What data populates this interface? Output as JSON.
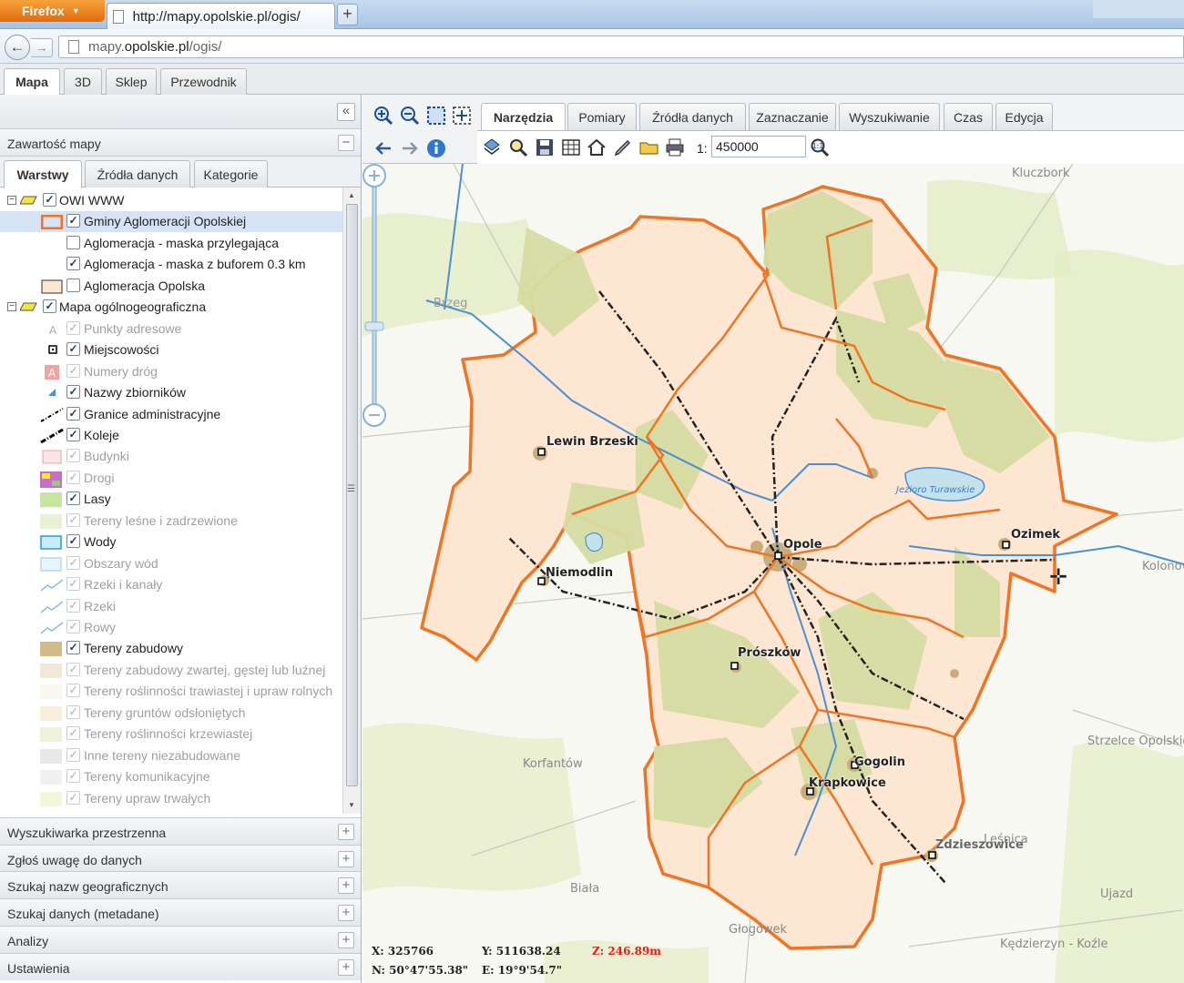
{
  "browser": {
    "app_button": "Firefox",
    "tab_title": "http://mapy.opolskie.pl/ogis/",
    "url_prefix": "mapy.",
    "url_domain": "opolskie.pl",
    "url_suffix": "/ogis/"
  },
  "app_tabs": [
    "Mapa",
    "3D",
    "Sklep",
    "Przewodnik"
  ],
  "left": {
    "section_title": "Zawartość mapy",
    "subtabs": [
      "Warstwy",
      "Źródła danych",
      "Kategorie"
    ],
    "tree": [
      {
        "label": "OWI WWW",
        "checked": true,
        "dim": false
      },
      {
        "label": "Gminy Aglomeracji Opolskiej",
        "checked": true,
        "dim": false
      },
      {
        "label": "Aglomeracja - maska przylegająca",
        "checked": false,
        "dim": false
      },
      {
        "label": "Aglomeracja - maska z buforem 0.3 km",
        "checked": true,
        "dim": false
      },
      {
        "label": "Aglomeracja Opolska",
        "checked": false,
        "dim": false
      },
      {
        "label": "Mapa ogólnogeograficzna",
        "checked": true,
        "dim": false
      },
      {
        "label": "Punkty adresowe",
        "checked": false,
        "dim": true
      },
      {
        "label": "Miejscowości",
        "checked": true,
        "dim": false
      },
      {
        "label": "Numery dróg",
        "checked": false,
        "dim": true
      },
      {
        "label": "Nazwy zbiorników",
        "checked": true,
        "dim": false
      },
      {
        "label": "Granice administracyjne",
        "checked": true,
        "dim": false
      },
      {
        "label": "Koleje",
        "checked": true,
        "dim": false
      },
      {
        "label": "Budynki",
        "checked": false,
        "dim": true
      },
      {
        "label": "Drogi",
        "checked": false,
        "dim": true
      },
      {
        "label": "Lasy",
        "checked": true,
        "dim": false
      },
      {
        "label": "Tereny leśne i zadrzewione",
        "checked": false,
        "dim": true
      },
      {
        "label": "Wody",
        "checked": true,
        "dim": false
      },
      {
        "label": "Obszary wód",
        "checked": false,
        "dim": true
      },
      {
        "label": "Rzeki i kanały",
        "checked": false,
        "dim": true
      },
      {
        "label": "Rzeki",
        "checked": false,
        "dim": true
      },
      {
        "label": "Rowy",
        "checked": false,
        "dim": true
      },
      {
        "label": "Tereny zabudowy",
        "checked": true,
        "dim": false
      },
      {
        "label": "Tereny zabudowy zwartej, gęstej lub luźnej",
        "checked": false,
        "dim": true
      },
      {
        "label": "Tereny roślinności trawiastej i upraw rolnych",
        "checked": false,
        "dim": true
      },
      {
        "label": "Tereny gruntów odsłoniętych",
        "checked": false,
        "dim": true
      },
      {
        "label": "Tereny roślinności krzewiastej",
        "checked": false,
        "dim": true
      },
      {
        "label": "Inne tereny niezabudowane",
        "checked": false,
        "dim": true
      },
      {
        "label": "Tereny komunikacyjne",
        "checked": false,
        "dim": true
      },
      {
        "label": "Tereny upraw trwałych",
        "checked": false,
        "dim": true
      }
    ],
    "accordions": [
      "Wyszukiwarka przestrzenna",
      "Zgłoś uwagę do danych",
      "Szukaj nazw geograficznych",
      "Szukaj danych (metadane)",
      "Analizy",
      "Ustawienia"
    ]
  },
  "toolbar": {
    "tabs": [
      "Narzędzia",
      "Pomiary",
      "Źródła danych",
      "Zaznaczanie",
      "Wyszukiwanie",
      "Czas",
      "Edycja"
    ],
    "scale_prefix": "1:",
    "scale_value": "450000"
  },
  "map": {
    "places": [
      "Kluczbork",
      "Brzeg",
      "Lewin Brzeski",
      "Opole",
      "Ozimek",
      "Niemodlin",
      "Prószków",
      "Gogolin",
      "Krapkowice",
      "Korfantów",
      "Strzelce Opolskie",
      "Zdzieszowice",
      "Leśnica",
      "Biała",
      "Ujazd",
      "Głogówek",
      "Kędzierzyn - Koźle",
      "Kolonow"
    ],
    "lake": "Jezioro Turawskie",
    "coords": {
      "x": "X: 325766",
      "y": "Y: 511638.24",
      "z": "Z: 246.89m",
      "n": "N: 50°47'55.38\"",
      "e": "E: 19°9'54.7\""
    },
    "colors": {
      "boundary": "#f07424",
      "gmina_fill": "#fde6d2",
      "forest": "#d6dca2",
      "water": "#4a8fd4",
      "built": "#c9ac7c"
    }
  }
}
